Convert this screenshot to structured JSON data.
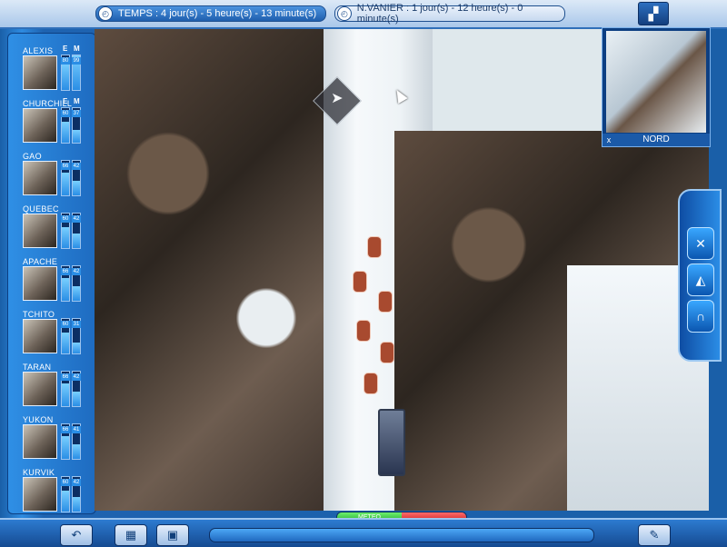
{
  "topbar": {
    "timer_left": "TEMPS : 4 jour(s) - 5 heure(s) - 13 minute(s)",
    "timer_right": "N.VANIER : 1 jour(s) - 12 heure(s) - 0 minute(s)"
  },
  "team": {
    "labels": {
      "e": "E",
      "m": "M"
    },
    "dogs": [
      {
        "name": "ALEXIS",
        "e": 80,
        "m": 99
      },
      {
        "name": "CHURCHILL",
        "e": 60,
        "m": 37
      },
      {
        "name": "GAO",
        "e": 66,
        "m": 42
      },
      {
        "name": "QUEBEC",
        "e": 60,
        "m": 42
      },
      {
        "name": "APACHE",
        "e": 66,
        "m": 42
      },
      {
        "name": "TCHITO",
        "e": 60,
        "m": 31
      },
      {
        "name": "TARAN",
        "e": 66,
        "m": 42
      },
      {
        "name": "YUKON",
        "e": 66,
        "m": 41
      },
      {
        "name": "KURVIK",
        "e": 60,
        "m": 42
      }
    ]
  },
  "minimap": {
    "direction": "NORD",
    "close": "x"
  },
  "status": {
    "meteo_label": "METEO",
    "danger_label": "..."
  },
  "colors": {
    "panel_blue": "#1e6bc0",
    "accent_light": "#7ad0ff"
  }
}
